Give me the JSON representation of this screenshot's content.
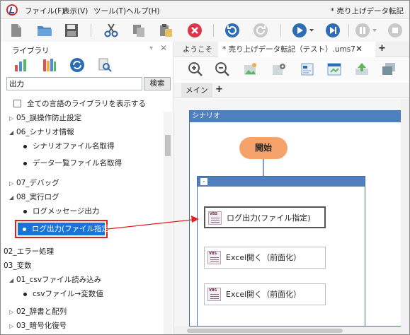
{
  "menu": {
    "file": "ファイル(F)",
    "view": "表示(V)",
    "tools": "ツール(T)",
    "help": "ヘルプ(H)",
    "window_title": "* 売り上げデータ転記"
  },
  "library": {
    "title": "ライブラリ",
    "search_value": "出力",
    "search_button": "検索",
    "show_all_languages": "全ての言語のライブラリを表示する",
    "tree": [
      {
        "label": "05_誤操作防止設定",
        "kind": "collapsed"
      },
      {
        "label": "06_シナリオ情報",
        "kind": "expanded"
      },
      {
        "label": "シナリオファイル名取得",
        "kind": "leaf"
      },
      {
        "label": "データ一覧ファイル名取得",
        "kind": "leaf"
      },
      {
        "label": "07_デバッグ",
        "kind": "collapsed"
      },
      {
        "label": "08_実行ログ",
        "kind": "expanded"
      },
      {
        "label": "ログメッセージ出力",
        "kind": "leaf"
      },
      {
        "label": "ログ出力(ファイル指定)",
        "kind": "selected"
      },
      {
        "label": "02_エラー処理",
        "kind": "root"
      },
      {
        "label": "03_変数",
        "kind": "root"
      },
      {
        "label": "01_csvファイル読み込み",
        "kind": "expanded"
      },
      {
        "label": "csvファイル→変数値",
        "kind": "leaf"
      },
      {
        "label": "02_辞書と配列",
        "kind": "collapsed"
      },
      {
        "label": "03_暗号化復号",
        "kind": "collapsed"
      }
    ]
  },
  "editor": {
    "tabs": [
      {
        "label": "ようこそ"
      },
      {
        "label": "* 売り上げデータ転記（テスト）.ums7"
      }
    ],
    "sub_tab": "メイン",
    "scenario_label": "シナリオ",
    "start_label": "開始",
    "seq_button": "-",
    "nodes": [
      {
        "label": "ログ出力(ファイル指定)"
      },
      {
        "label": "Excel開く（前面化）"
      },
      {
        "label": "Excel開く（前面化）"
      }
    ],
    "vbs_icon_text": "VBS"
  },
  "colors": {
    "selection_blue": "#1a73d9",
    "highlight_red": "#e0201b",
    "start_orange": "#f5a36b",
    "scenario_blue": "#4f7fbd"
  }
}
